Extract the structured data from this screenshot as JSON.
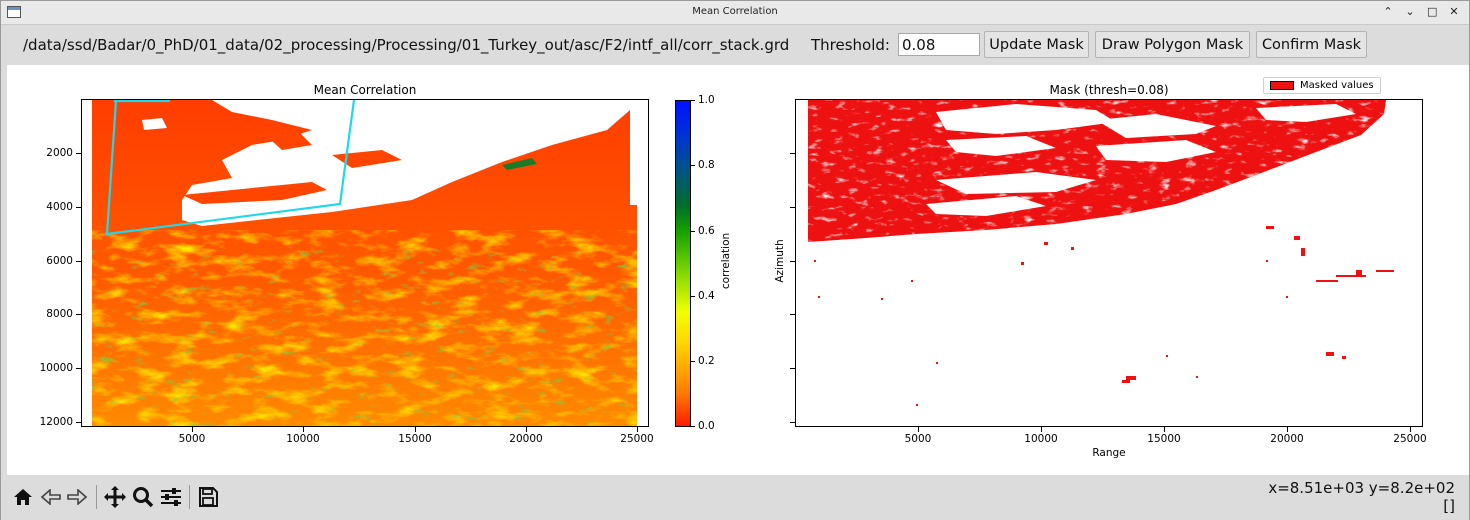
{
  "window": {
    "title": "Mean Correlation",
    "controls": {
      "minimize": "⌃",
      "restore": "⌄",
      "maximize": "□",
      "close": "✕"
    }
  },
  "toolbar": {
    "path": "/data/ssd/Badar/0_PhD/01_data/02_processing/Processing/01_Turkey_out/asc/F2/intf_all/corr_stack.grd",
    "threshold_label": "Threshold:",
    "threshold_value": "0.08",
    "update_mask_label": "Update Mask",
    "draw_polygon_label": "Draw Polygon Mask",
    "confirm_mask_label": "Confirm Mask"
  },
  "left_plot": {
    "title": "Mean Correlation",
    "x_ticks": [
      "5000",
      "10000",
      "15000",
      "20000",
      "25000"
    ],
    "y_ticks": [
      "2000",
      "4000",
      "6000",
      "8000",
      "10000",
      "12000"
    ],
    "colorbar_label": "correlation",
    "colorbar_ticks": [
      "1.0",
      "0.8",
      "0.6",
      "0.4",
      "0.2",
      "0.0"
    ]
  },
  "right_plot": {
    "title": "Mask (thresh=0.08)",
    "x_ticks": [
      "5000",
      "10000",
      "15000",
      "20000",
      "25000"
    ],
    "xlabel": "Range",
    "ylabel": "Azimuth",
    "legend_label": "Masked values",
    "legend_color": "#ee1111"
  },
  "navbar": {
    "icons": [
      "home-icon",
      "back-icon",
      "forward-icon",
      "pan-icon",
      "zoom-icon",
      "configure-subplots-icon",
      "save-icon"
    ],
    "coords_line1": "x=8.51e+03 y=8.2e+02",
    "coords_line2": "[]"
  },
  "colors": {
    "low_correlation": "#ff4a00",
    "mid_correlation": "#f0d800",
    "high_correlation": "#0a7a2a",
    "mask": "#ee1111",
    "polygon": "#22d8e8"
  }
}
